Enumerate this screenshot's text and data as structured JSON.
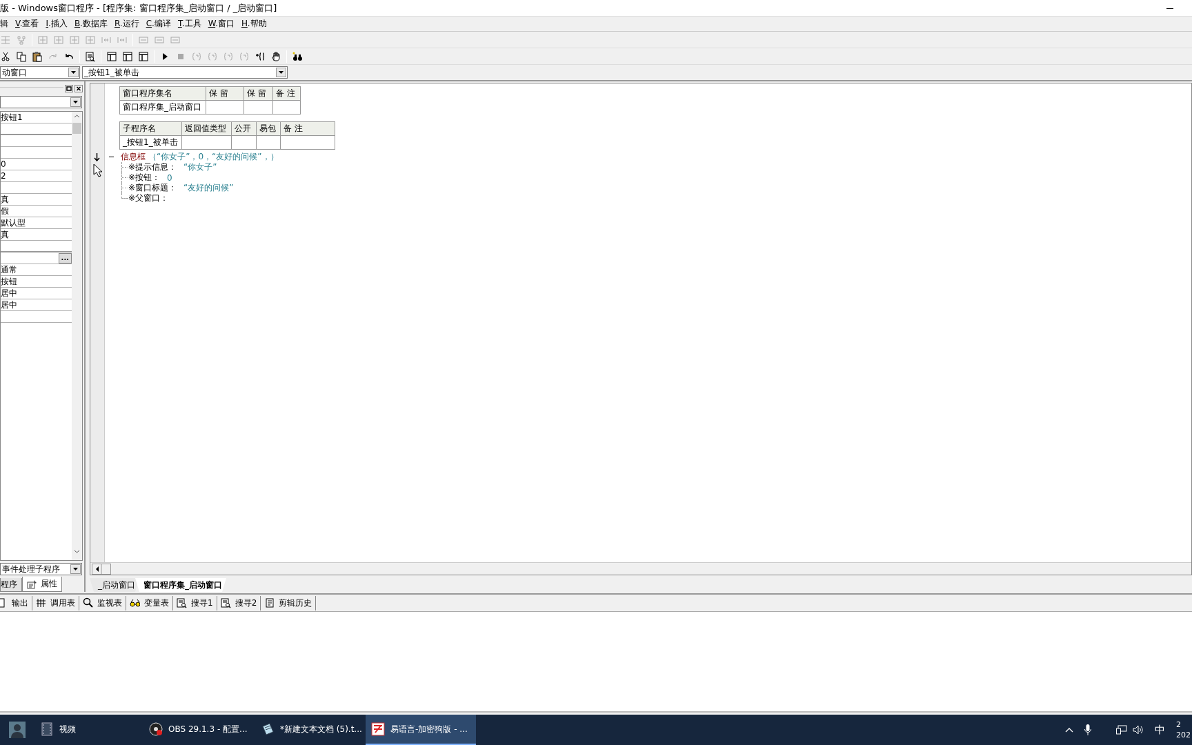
{
  "window": {
    "title": "版 - Windows窗口程序 - [程序集: 窗口程序集_启动窗口 / _启动窗口]"
  },
  "menu": [
    {
      "label": "辑",
      "underline": false
    },
    {
      "label": "V.查看",
      "underline": true
    },
    {
      "label": "I.插入",
      "underline": true
    },
    {
      "label": "B.数据库",
      "underline": true
    },
    {
      "label": "R.运行",
      "underline": true
    },
    {
      "label": "C.编译",
      "underline": true
    },
    {
      "label": "T.工具",
      "underline": true
    },
    {
      "label": "W.窗口",
      "underline": true
    },
    {
      "label": "H.帮助",
      "underline": true
    }
  ],
  "toolbar_1": [
    {
      "kind": "grid",
      "disabled": true
    },
    {
      "kind": "tree",
      "disabled": true
    },
    {
      "kind": "sep"
    },
    {
      "kind": "align",
      "disabled": true
    },
    {
      "kind": "align",
      "disabled": true
    },
    {
      "kind": "align",
      "disabled": true
    },
    {
      "kind": "align",
      "disabled": true
    },
    {
      "kind": "space",
      "disabled": true
    },
    {
      "kind": "space",
      "disabled": true
    },
    {
      "kind": "sep"
    },
    {
      "kind": "size",
      "disabled": true
    },
    {
      "kind": "size",
      "disabled": true
    },
    {
      "kind": "size",
      "disabled": true
    }
  ],
  "toolbar_2": [
    {
      "kind": "cut",
      "disabled": false
    },
    {
      "kind": "copy",
      "disabled": false
    },
    {
      "kind": "paste",
      "disabled": false
    },
    {
      "kind": "redo",
      "disabled": true
    },
    {
      "kind": "undo",
      "disabled": false
    },
    {
      "kind": "sep"
    },
    {
      "kind": "find",
      "disabled": false
    },
    {
      "kind": "sep"
    },
    {
      "kind": "layout",
      "disabled": false
    },
    {
      "kind": "layout",
      "disabled": false
    },
    {
      "kind": "layout",
      "disabled": false
    },
    {
      "kind": "sep"
    },
    {
      "kind": "run",
      "disabled": false
    },
    {
      "kind": "stop",
      "disabled": true
    },
    {
      "kind": "step",
      "disabled": true
    },
    {
      "kind": "step",
      "disabled": true
    },
    {
      "kind": "step",
      "disabled": true
    },
    {
      "kind": "step",
      "disabled": true
    },
    {
      "kind": "braces",
      "disabled": false
    },
    {
      "kind": "hand",
      "disabled": false
    },
    {
      "kind": "sep"
    },
    {
      "kind": "binoculars",
      "disabled": false
    }
  ],
  "combos": [
    {
      "value": "动窗口"
    },
    {
      "value": "_按钮1_被单击"
    }
  ],
  "left_panel": {
    "rows": [
      {
        "kind": "text",
        "value": "按钮1"
      },
      {
        "kind": "blank"
      },
      {
        "kind": "blank"
      },
      {
        "kind": "blank"
      },
      {
        "kind": "text",
        "value": "0"
      },
      {
        "kind": "text",
        "value": "2"
      },
      {
        "kind": "blank"
      },
      {
        "kind": "text",
        "value": "真"
      },
      {
        "kind": "text",
        "value": "假"
      },
      {
        "kind": "text",
        "value": "默认型"
      },
      {
        "kind": "text",
        "value": "真"
      },
      {
        "kind": "blank"
      },
      {
        "kind": "button",
        "label": "..."
      },
      {
        "kind": "text",
        "value": "通常"
      },
      {
        "kind": "text",
        "value": "按钮"
      },
      {
        "kind": "text",
        "value": "居中"
      },
      {
        "kind": "text",
        "value": "居中"
      },
      {
        "kind": "blank"
      }
    ],
    "event_combo": {
      "value": "事件处理子程序"
    },
    "tabs": [
      {
        "label": "程序",
        "selected": false
      },
      {
        "label": "属性",
        "selected": true
      }
    ]
  },
  "editor": {
    "assembly_table": {
      "columns": [
        "窗口程序集名",
        "保 留",
        "保 留",
        "备 注"
      ],
      "rows": [
        [
          "窗口程序集_启动窗口",
          "",
          "",
          ""
        ]
      ]
    },
    "sub_table": {
      "columns": [
        "子程序名",
        "返回值类型",
        "公开",
        "易包",
        "备 注"
      ],
      "rows": [
        [
          "_按钮1_被单击",
          "",
          "",
          "",
          ""
        ]
      ]
    },
    "code_line": {
      "command": "信息框",
      "args": "（“你女子”，0，“友好的问候”，）",
      "expanded": true
    },
    "hints": [
      {
        "label": "※提示信息：",
        "value": "“你女子”"
      },
      {
        "label": "※按钮：",
        "value": "0"
      },
      {
        "label": "※窗口标题：",
        "value": "“友好的问候”"
      },
      {
        "label": "※父窗口："
      }
    ]
  },
  "file_tabs": [
    {
      "label": "_启动窗口",
      "selected": false
    },
    {
      "label": "窗口程序集_启动窗口",
      "selected": true
    }
  ],
  "output_tabs": [
    {
      "label": "输出"
    },
    {
      "label": "调用表"
    },
    {
      "label": "监视表"
    },
    {
      "label": "变量表"
    },
    {
      "label": "搜寻1"
    },
    {
      "label": "搜寻2"
    },
    {
      "label": "剪辑历史"
    }
  ],
  "taskbar": {
    "items": [
      {
        "kind": "avatar"
      },
      {
        "kind": "app",
        "label": "视频",
        "selected": false
      },
      {
        "kind": "app",
        "label": "OBS 29.1.3 - 配置...",
        "selected": false
      },
      {
        "kind": "app",
        "label": "*新建文本文档 (5).t...",
        "selected": false
      },
      {
        "kind": "app",
        "label": "易语言-加密狗版 - ...",
        "selected": true
      }
    ],
    "input_method": "中",
    "clock": {
      "time": "2",
      "date": "202"
    }
  }
}
